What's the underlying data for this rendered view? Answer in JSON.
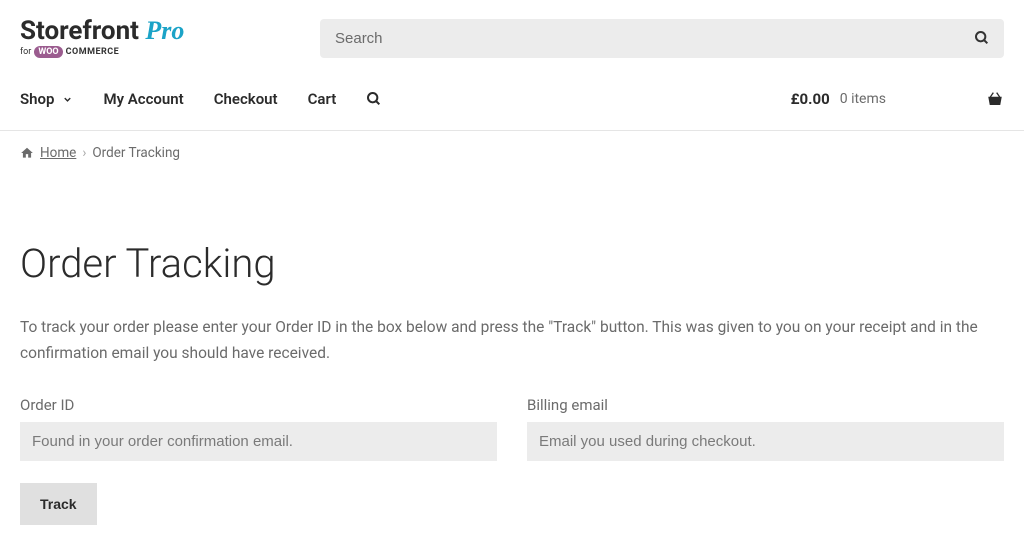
{
  "logo": {
    "brand_main": "Storefront",
    "brand_accent": "Pro",
    "for": "for",
    "woo": "WOO",
    "commerce": "COMMERCE"
  },
  "search": {
    "placeholder": "Search"
  },
  "nav": {
    "shop": "Shop",
    "account": "My Account",
    "checkout": "Checkout",
    "cart": "Cart"
  },
  "cart_summary": {
    "total": "£0.00",
    "items": "0 items"
  },
  "breadcrumb": {
    "home": "Home",
    "sep": "›",
    "current": "Order Tracking"
  },
  "page": {
    "title": "Order Tracking",
    "desc": "To track your order please enter your Order ID in the box below and press the \"Track\" button. This was given to you on your receipt and in the confirmation email you should have received."
  },
  "form": {
    "order_label": "Order ID",
    "order_placeholder": "Found in your order confirmation email.",
    "email_label": "Billing email",
    "email_placeholder": "Email you used during checkout.",
    "submit": "Track"
  }
}
